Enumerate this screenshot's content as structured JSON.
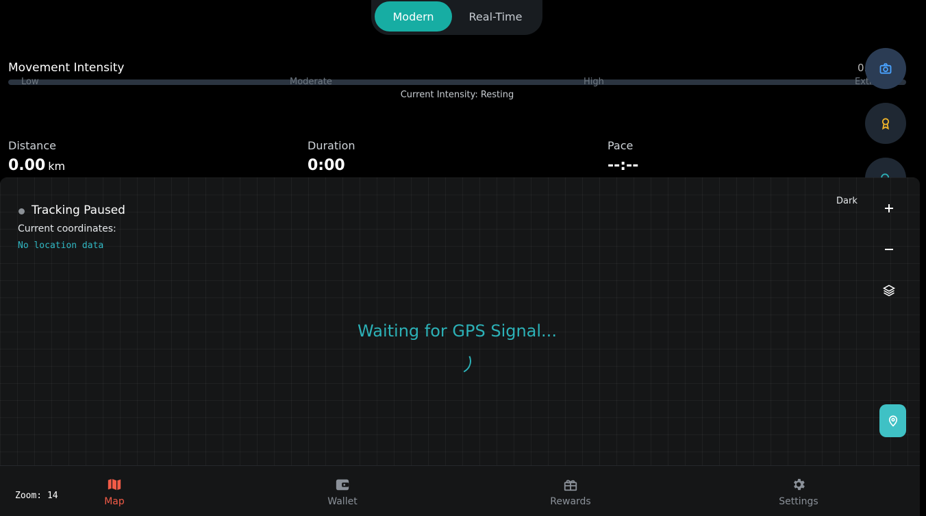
{
  "mode_toggle": {
    "active": "Modern",
    "inactive": "Real-Time"
  },
  "intensity": {
    "title": "Movement Intensity",
    "value": "0.",
    "ticks": [
      "Low",
      "Moderate",
      "High",
      "Extr"
    ],
    "current": "Current Intensity: Resting"
  },
  "stats": {
    "distance": {
      "label": "Distance",
      "value": "0.00",
      "unit": "km"
    },
    "duration": {
      "label": "Duration",
      "value": "0:00"
    },
    "pace": {
      "label": "Pace",
      "value": "--:--"
    }
  },
  "map": {
    "status": "Tracking Paused",
    "coords_label": "Current coordinates:",
    "coords_value": "No location data",
    "theme": "Dark",
    "waiting": "Waiting for GPS Signal...",
    "zoom_label": "Zoom: 14",
    "zoom_in": "+",
    "zoom_out": "−"
  },
  "nav": [
    {
      "label": "Map",
      "icon": "map-icon"
    },
    {
      "label": "Wallet",
      "icon": "wallet-icon"
    },
    {
      "label": "Rewards",
      "icon": "gift-icon"
    },
    {
      "label": "Settings",
      "icon": "gear-icon"
    }
  ],
  "colors": {
    "accent": "#17ada3",
    "active_nav": "#f15b47",
    "signal": "#2cb1b7"
  }
}
